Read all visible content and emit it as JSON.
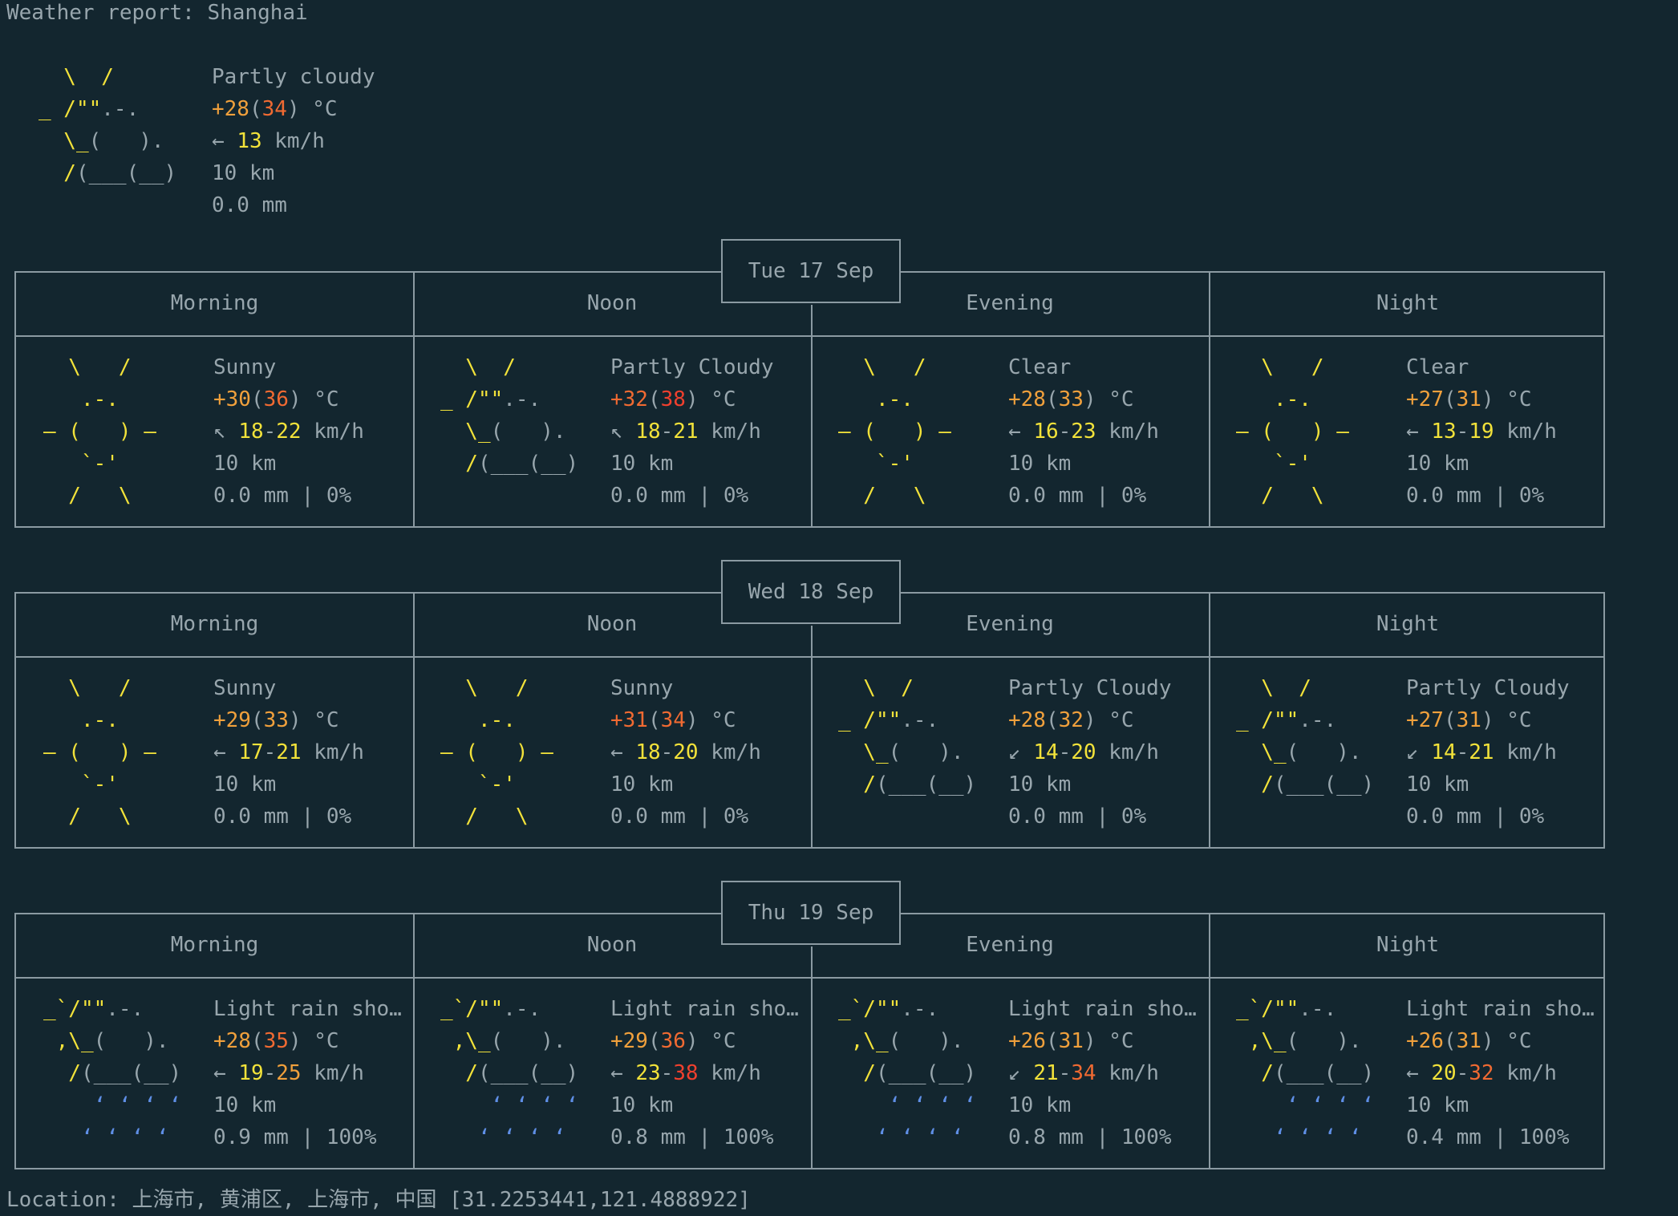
{
  "title": "Weather report: Shanghai",
  "current": {
    "icon": "partly-cloudy",
    "condition": "Partly cloudy",
    "temp": "+28",
    "feels": "34",
    "unit": "°C",
    "wind_arrow": "←",
    "wind": "13",
    "wind_unit": "km/h",
    "visibility": "10 km",
    "precip": "0.0 mm"
  },
  "colors": {
    "background": "#13262f",
    "text": "#98a6ad",
    "sun": "#f2e23a",
    "rain": "#5f8fe6",
    "temp_warm": "#f0a03c",
    "temp_hot": "#f06a32",
    "wind_high": "#f0402e"
  },
  "days": [
    {
      "date": "Tue 17 Sep",
      "periods": [
        {
          "name": "Morning",
          "icon": "sunny",
          "condition": "Sunny",
          "temp": "+30",
          "feels": "36",
          "feels_color": "r",
          "wind_arrow": "↖",
          "wind_min": "18",
          "wind_max": "22",
          "max_color": "y",
          "visibility": "10 km",
          "precip": "0.0 mm | 0%"
        },
        {
          "name": "Noon",
          "icon": "partly-cloudy",
          "condition": "Partly Cloudy",
          "temp": "+32",
          "temp_color": "r",
          "feels": "38",
          "feels_color": "rd",
          "wind_arrow": "↖",
          "wind_min": "18",
          "wind_max": "21",
          "max_color": "y",
          "visibility": "10 km",
          "precip": "0.0 mm | 0%"
        },
        {
          "name": "Evening",
          "icon": "sunny",
          "condition": "Clear",
          "temp": "+28",
          "feels": "33",
          "feels_color": "o",
          "wind_arrow": "←",
          "wind_min": "16",
          "wind_max": "23",
          "max_color": "y",
          "visibility": "10 km",
          "precip": "0.0 mm | 0%"
        },
        {
          "name": "Night",
          "icon": "sunny",
          "condition": "Clear",
          "temp": "+27",
          "feels": "31",
          "feels_color": "o",
          "wind_arrow": "←",
          "wind_min": "13",
          "wind_max": "19",
          "max_color": "y",
          "visibility": "10 km",
          "precip": "0.0 mm | 0%"
        }
      ]
    },
    {
      "date": "Wed 18 Sep",
      "periods": [
        {
          "name": "Morning",
          "icon": "sunny",
          "condition": "Sunny",
          "temp": "+29",
          "feels": "33",
          "feels_color": "o",
          "wind_arrow": "←",
          "wind_min": "17",
          "wind_max": "21",
          "max_color": "y",
          "visibility": "10 km",
          "precip": "0.0 mm | 0%"
        },
        {
          "name": "Noon",
          "icon": "sunny",
          "condition": "Sunny",
          "temp": "+31",
          "temp_color": "r",
          "feels": "34",
          "feels_color": "r",
          "wind_arrow": "←",
          "wind_min": "18",
          "wind_max": "20",
          "max_color": "y",
          "visibility": "10 km",
          "precip": "0.0 mm | 0%"
        },
        {
          "name": "Evening",
          "icon": "partly-cloudy",
          "condition": "Partly Cloudy",
          "temp": "+28",
          "feels": "32",
          "feels_color": "o",
          "wind_arrow": "↙",
          "wind_min": "14",
          "wind_max": "20",
          "max_color": "y",
          "visibility": "10 km",
          "precip": "0.0 mm | 0%"
        },
        {
          "name": "Night",
          "icon": "partly-cloudy",
          "condition": "Partly Cloudy",
          "temp": "+27",
          "feels": "31",
          "feels_color": "o",
          "wind_arrow": "↙",
          "wind_min": "14",
          "wind_max": "21",
          "max_color": "y",
          "visibility": "10 km",
          "precip": "0.0 mm | 0%"
        }
      ]
    },
    {
      "date": "Thu 19 Sep",
      "periods": [
        {
          "name": "Morning",
          "icon": "light-rain-showers",
          "condition": "Light rain sho…",
          "temp": "+28",
          "feels": "35",
          "feels_color": "r",
          "wind_arrow": "←",
          "wind_min": "19",
          "wind_max": "25",
          "max_color": "o",
          "visibility": "10 km",
          "precip": "0.9 mm | 100%"
        },
        {
          "name": "Noon",
          "icon": "light-rain-showers",
          "condition": "Light rain sho…",
          "temp": "+29",
          "feels": "36",
          "feels_color": "r",
          "wind_arrow": "←",
          "wind_min": "23",
          "wind_max": "38",
          "max_color": "rd",
          "visibility": "10 km",
          "precip": "0.8 mm | 100%"
        },
        {
          "name": "Evening",
          "icon": "light-rain-showers",
          "condition": "Light rain sho…",
          "temp": "+26",
          "feels": "31",
          "feels_color": "o",
          "wind_arrow": "↙",
          "wind_min": "21",
          "wind_max": "34",
          "max_color": "r",
          "visibility": "10 km",
          "precip": "0.8 mm | 100%"
        },
        {
          "name": "Night",
          "icon": "light-rain-showers",
          "condition": "Light rain sho…",
          "temp": "+26",
          "feels": "31",
          "feels_color": "o",
          "wind_arrow": "←",
          "wind_min": "20",
          "wind_max": "32",
          "max_color": "r",
          "visibility": "10 km",
          "precip": "0.4 mm | 100%"
        }
      ]
    }
  ],
  "temp_unit": "°C",
  "wind_unit": "km/h",
  "location": "Location: 上海市, 黄浦区, 上海市, 中国 [31.2253441,121.4888922]"
}
